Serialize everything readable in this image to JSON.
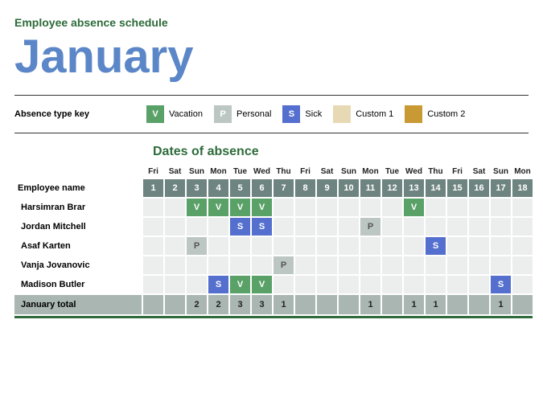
{
  "header": {
    "subtitle": "Employee absence schedule",
    "month": "January"
  },
  "legend": {
    "label": "Absence type key",
    "items": [
      {
        "code": "V",
        "label": "Vacation",
        "swatch": "sw-vacation"
      },
      {
        "code": "P",
        "label": "Personal",
        "swatch": "sw-personal"
      },
      {
        "code": "S",
        "label": "Sick",
        "swatch": "sw-sick"
      },
      {
        "code": "",
        "label": "Custom 1",
        "swatch": "sw-custom1"
      },
      {
        "code": "",
        "label": "Custom 2",
        "swatch": "sw-custom2"
      }
    ]
  },
  "section_title": "Dates of absence",
  "columns": {
    "employee_header": "Employee name",
    "days_of_week": [
      "Fri",
      "Sat",
      "Sun",
      "Mon",
      "Tue",
      "Wed",
      "Thu",
      "Fri",
      "Sat",
      "Sun",
      "Mon",
      "Tue",
      "Wed",
      "Thu",
      "Fri",
      "Sat",
      "Sun",
      "Mon"
    ],
    "day_numbers": [
      "1",
      "2",
      "3",
      "4",
      "5",
      "6",
      "7",
      "8",
      "9",
      "10",
      "11",
      "12",
      "13",
      "14",
      "15",
      "16",
      "17",
      "18"
    ]
  },
  "employees": [
    {
      "name": "Harsimran Brar",
      "cells": [
        "",
        "",
        "V",
        "V",
        "V",
        "V",
        "",
        "",
        "",
        "",
        "",
        "",
        "V",
        "",
        "",
        "",
        "",
        ""
      ]
    },
    {
      "name": "Jordan Mitchell",
      "cells": [
        "",
        "",
        "",
        "",
        "S",
        "S",
        "",
        "",
        "",
        "",
        "P",
        "",
        "",
        "",
        "",
        "",
        "",
        ""
      ]
    },
    {
      "name": "Asaf Karten",
      "cells": [
        "",
        "",
        "P",
        "",
        "",
        "",
        "",
        "",
        "",
        "",
        "",
        "",
        "",
        "S",
        "",
        "",
        "",
        ""
      ]
    },
    {
      "name": "Vanja Jovanovic",
      "cells": [
        "",
        "",
        "",
        "",
        "",
        "",
        "P",
        "",
        "",
        "",
        "",
        "",
        "",
        "",
        "",
        "",
        "",
        ""
      ]
    },
    {
      "name": "Madison Butler",
      "cells": [
        "",
        "",
        "",
        "S",
        "V",
        "V",
        "",
        "",
        "",
        "",
        "",
        "",
        "",
        "",
        "",
        "",
        "S",
        ""
      ]
    }
  ],
  "totals": {
    "label": "January total",
    "values": [
      "",
      "",
      "2",
      "2",
      "3",
      "3",
      "1",
      "",
      "",
      "",
      "1",
      "",
      "1",
      "1",
      "",
      "",
      "1",
      ""
    ]
  }
}
